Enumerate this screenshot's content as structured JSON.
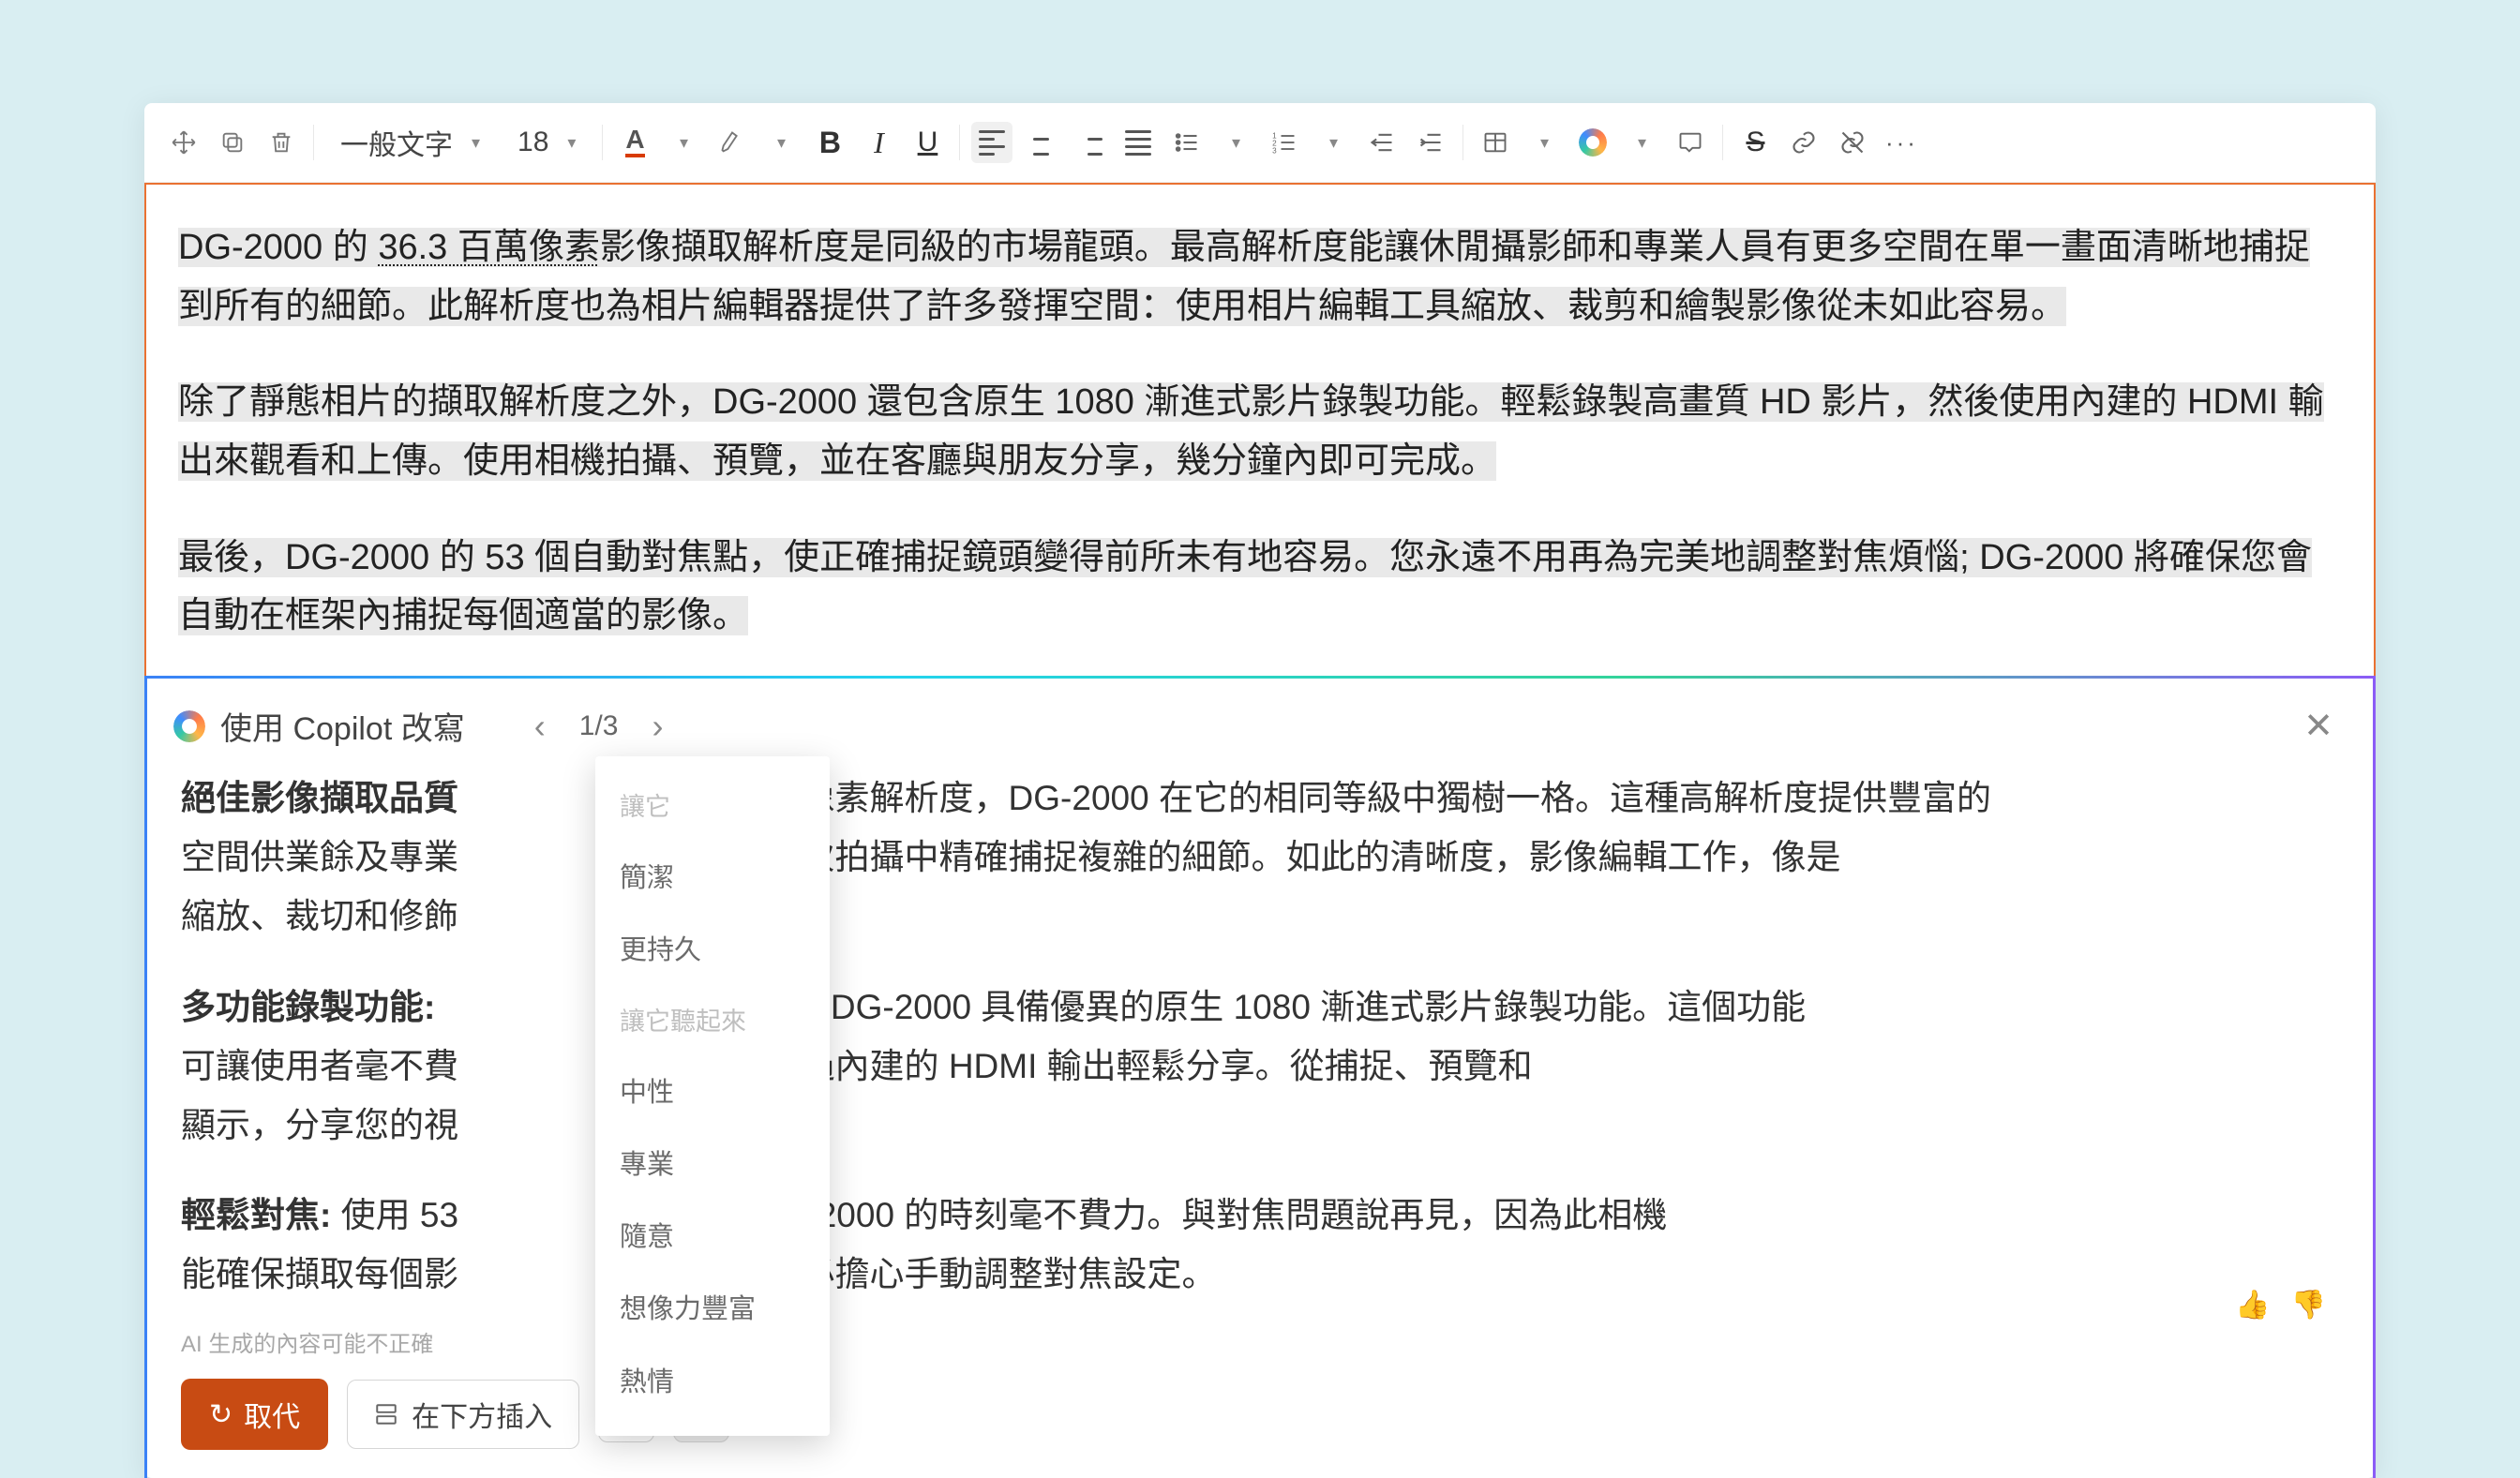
{
  "toolbar": {
    "style_combo": "一般文字",
    "font_size": "18"
  },
  "document": {
    "p1_a": "DG-2000 的 ",
    "p1_b": "36.3 百萬像素",
    "p1_c": "影像擷取解析度是同級的市場龍頭。最高解析度能讓休閒攝影師和專業人員有更多空間在單一畫面清晰地捕捉到所有的細節。此解析度也為相片編輯器提供了許多發揮空間：使用相片編輯工具縮放、裁剪和繪製影像從未如此容易。",
    "p2": "除了靜態相片的擷取解析度之外，DG-2000 還包含原生 1080 漸進式影片錄製功能。輕鬆錄製高畫質 HD 影片，然後使用內建的 HDMI 輸出來觀看和上傳。使用相機拍攝、預覽，並在客廳與朋友分享，幾分鐘內即可完成。",
    "p3": "最後，DG-2000 的 53 個自動對焦點，使正確捕捉鏡頭變得前所未有地容易。您永遠不用再為完美地調整對焦煩惱; DG-2000 將確保您會自動在框架內捕捉每個適當的影像。"
  },
  "copilot": {
    "title": "使用 Copilot 改寫",
    "pager": "1/3",
    "body": {
      "h1": "絕佳影像擷取品質",
      "l1": "百萬像素解析度，DG-2000 在它的相同等級中獨樹一格。這種高解析度提供豐富的",
      "l2": "空間供業餘及專業",
      "l2b": "在一次拍攝中精確捕捉複雜的細節。如此的清晰度，影像編輯工作，像是",
      "l3": "縮放、裁切和修飾",
      "h2": "多功能錄製功能:",
      "l4": "品質，DG-2000 具備優異的原生 1080 漸進式影片錄製功能。這個功能",
      "l5": "可讓使用者毫不費",
      "l5b": "並透過內建的 HDMI 輸出輕鬆分享。從捕捉、預覽和",
      "l6": "顯示，分享您的視",
      "h3": "輕鬆對焦:",
      "l7a": " 使用 53",
      "l7b": "使用 DG-2000 的時刻毫不費力。與對焦問題說再見，因為此相機",
      "l8": "能確保擷取每個影",
      "l8b": "您不必擔心手動調整對焦設定。"
    },
    "tone": {
      "label1": "讓它",
      "opt1": "簡潔",
      "opt2": "更持久",
      "label2": "讓它聽起來",
      "opt3": "中性",
      "opt4": "專業",
      "opt5": "隨意",
      "opt6": "想像力豐富",
      "opt7": "熱情"
    },
    "disclaimer": "AI 生成的內容可能不正確",
    "btn_replace": "取代",
    "btn_insert": "在下方插入"
  }
}
